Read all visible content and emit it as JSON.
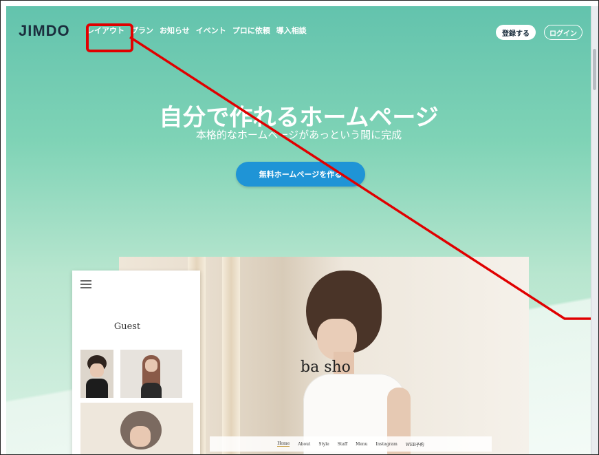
{
  "header": {
    "logo": "JIMDO",
    "nav": [
      "レイアウト",
      "プラン",
      "お知らせ",
      "イベント",
      "プロに依頼",
      "導入相談"
    ],
    "register": "登録する",
    "login": "ログイン"
  },
  "hero": {
    "title": "自分で作れるホームページ",
    "subtitle": "本格的なホームページがあっという間に完成",
    "cta": "無料ホームページを作る"
  },
  "preview": {
    "phone_title": "Guest",
    "desktop_brand": "ba sho",
    "desktop_nav": [
      "Home",
      "About",
      "Style",
      "Staff",
      "Menu",
      "Instagram",
      "WEB予約"
    ]
  },
  "annotation": {
    "color": "#e00000"
  },
  "colors": {
    "accent": "#1f94d6",
    "brand_dark": "#1b2e3e",
    "bg_top": "#63c3ad",
    "bg_bottom": "#d9f1e4"
  }
}
